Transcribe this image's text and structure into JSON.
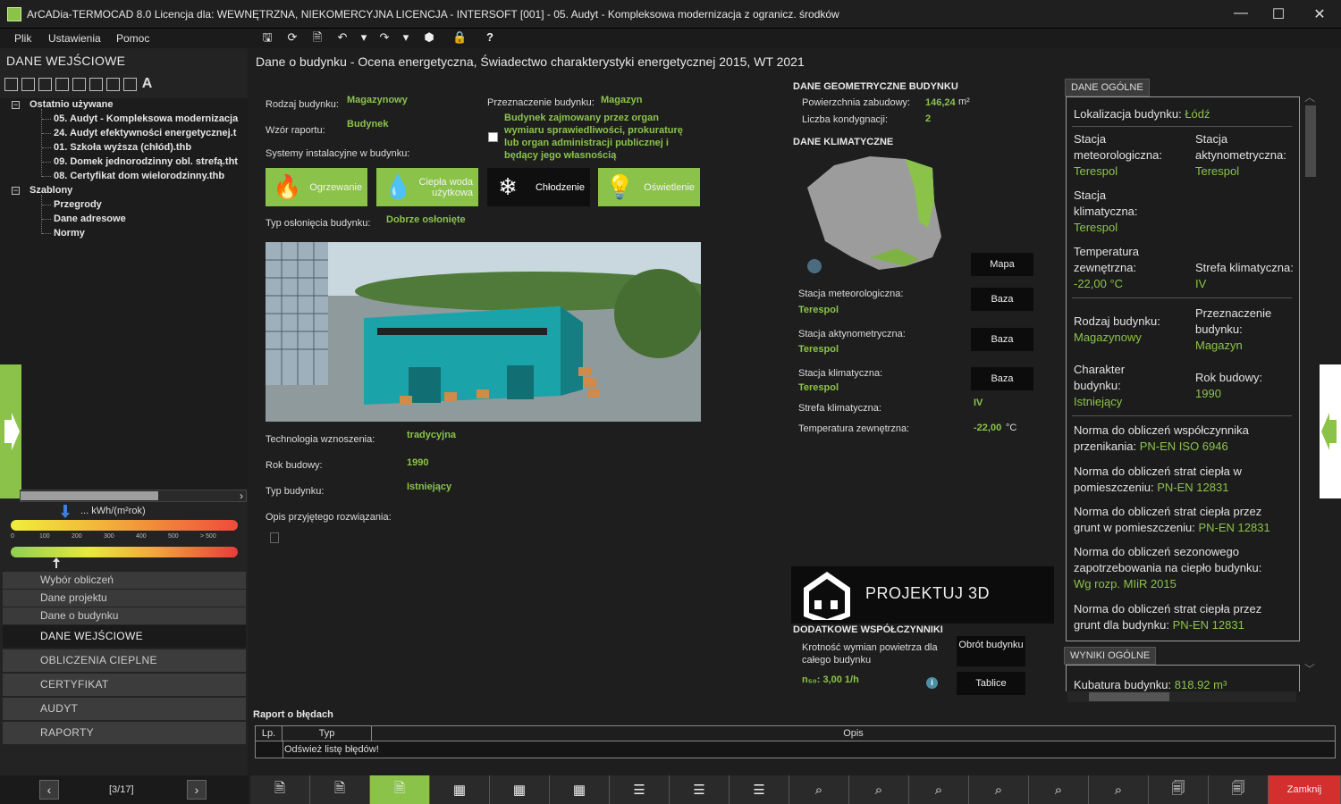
{
  "window": {
    "title": "ArCADia-TERMOCAD 8.0 Licencja dla: WEWNĘTRZNA, NIEKOMERCYJNA LICENCJA - INTERSOFT [001] - 05. Audyt - Kompleksowa modernizacja z ogranicz. środków",
    "min": "—",
    "max": "☐",
    "close": "✕"
  },
  "menu": {
    "plik": "Plik",
    "ustawienia": "Ustawienia",
    "pomoc": "Pomoc"
  },
  "toolbar": {
    "save": "🖫",
    "refresh": "⟳",
    "doc": "🗎",
    "undo": "↶",
    "undo_dd": "▾",
    "redo": "↷",
    "redo_dd": "▾",
    "box": "⬢",
    "lock": "🔒",
    "help": "?"
  },
  "left": {
    "header": "DANE WEJŚCIOWE",
    "tree": {
      "recent_label": "Ostatnio używane",
      "recent": [
        "05. Audyt - Kompleksowa modernizacja",
        "24. Audyt efektywności energetycznej.t",
        "01. Szkoła wyższa (chłód).thb",
        "09. Domek jednorodzinny obl. strefą.tht",
        "08. Certyfikat dom wielorodzinny.thb"
      ],
      "templates_label": "Szablony",
      "templates": [
        "Przegrody",
        "Dane adresowe",
        "Normy"
      ],
      "expand": "−"
    },
    "energy": {
      "unit": "... kWh/(m²rok)",
      "ticks": [
        "0",
        "100",
        "200",
        "300",
        "400",
        "500",
        "> 500"
      ]
    },
    "nav": [
      "Wybór obliczeń",
      "Dane projektu",
      "Dane o budynku"
    ],
    "big": [
      "DANE WEJŚCIOWE",
      "OBLICZENIA CIEPLNE",
      "CERTYFIKAT",
      "AUDYT",
      "RAPORTY"
    ],
    "pager": {
      "prev": "‹",
      "next": "›",
      "label": "[3/17]"
    },
    "scroll_right": "›"
  },
  "main": {
    "title": "Dane o budynku - Ocena energetyczna, Świadectwo charakterystyki energetycznej 2015, WT 2021",
    "rodzaj_lbl": "Rodzaj budynku:",
    "rodzaj_val": "Magazynowy",
    "wzor_lbl": "Wzór raportu:",
    "wzor_val": "Budynek",
    "przezn_lbl": "Przeznaczenie budynku:",
    "przezn_val": "Magazyn",
    "checkbox_text": "Budynek zajmowany przez organ wymiaru sprawiedliwości, prokuraturę lub organ administracji publicznej i będący jego własnością",
    "systemy_lbl": "Systemy instalacyjne w budynku:",
    "systems": [
      {
        "label": "Ogrzewanie",
        "icon": "🔥"
      },
      {
        "label": "Ciepła woda użytkowa",
        "icon": "💧"
      },
      {
        "label": "Chłodzenie",
        "icon": "❄"
      },
      {
        "label": "Oświetlenie",
        "icon": "💡"
      }
    ],
    "oslon_lbl": "Typ osłonięcia budynku:",
    "oslon_val": "Dobrze osłonięte",
    "techn_lbl": "Technologia wznoszenia:",
    "techn_val": "tradycyjna",
    "rok_lbl": "Rok budowy:",
    "rok_val": "1990",
    "typ_lbl": "Typ budynku:",
    "typ_val": "Istniejący",
    "opis_lbl": "Opis przyjętego rozwiązania:"
  },
  "geo": {
    "header": "DANE GEOMETRYCZNE BUDYNKU",
    "pow_lbl": "Powierzchnia zabudowy:",
    "pow_val": "146,24",
    "pow_unit": "m²",
    "kond_lbl": "Liczba kondygnacji:",
    "kond_val": "2"
  },
  "klim": {
    "header": "DANE KLIMATYCZNE",
    "mapa": "Mapa",
    "baza": "Baza",
    "meteo_lbl": "Stacja meteorologiczna:",
    "meteo_val": "Terespol",
    "akty_lbl": "Stacja aktynometryczna:",
    "akty_val": "Terespol",
    "stk_lbl": "Stacja klimatyczna:",
    "stk_val": "Terespol",
    "strefa_lbl": "Strefa klimatyczna:",
    "strefa_val": "IV",
    "temp_lbl": "Temperatura zewnętrzna:",
    "temp_val": "-22,00",
    "temp_unit": "°C"
  },
  "proj": {
    "label": "PROJEKTUJ 3D"
  },
  "dodatkowe": {
    "header": "DODATKOWE WSPÓŁCZYNNIKI",
    "krot_lbl": "Krotność wymian powietrza dla całego budynku",
    "n50": "n₅₀: 3,00 1/h",
    "obrot": "Obrót budynku",
    "tablice": "Tablice",
    "info": "i"
  },
  "right": {
    "tab_ogolne": "DANE OGÓLNE",
    "tab_wyniki": "WYNIKI OGÓLNE",
    "lok_lbl": "Lokalizacja budynku:",
    "lok_val": "Łódź",
    "st_meteo_lbl": "Stacja meteorologiczna:",
    "st_meteo_val": "Terespol",
    "st_akty_lbl": "Stacja aktynometryczna:",
    "st_akty_val": "Terespol",
    "st_klim_lbl": "Stacja klimatyczna:",
    "st_klim_val": "Terespol",
    "temp_lbl": "Temperatura zewnętrzna:",
    "temp_val": "-22,00 °C",
    "strefa_lbl": "Strefa klimatyczna:",
    "strefa_val": "IV",
    "rodzaj_lbl": "Rodzaj budynku:",
    "rodzaj_val": "Magazynowy",
    "przezn_lbl": "Przeznaczenie budynku:",
    "przezn_val": "Magazyn",
    "char_lbl": "Charakter budynku:",
    "char_val": "Istniejący",
    "rok_lbl": "Rok budowy:",
    "rok_val": "1990",
    "n1_lbl": "Norma do obliczeń współczynnika przenikania:",
    "n1_val": "PN-EN ISO 6946",
    "n2_lbl": "Norma do obliczeń strat ciepła w pomieszczeniu:",
    "n2_val": "PN-EN 12831",
    "n3_lbl": "Norma do obliczeń strat ciepła przez grunt w pomieszczeniu:",
    "n3_val": "PN-EN 12831",
    "n4_lbl": "Norma do obliczeń sezonowego zapotrzebowania na ciepło budynku:",
    "n4_val": "Wg rozp. MIiR 2015",
    "n5_lbl": "Norma do obliczeń strat ciepła przez grunt dla budynku:",
    "n5_val": "PN-EN 12831",
    "kub_lbl": "Kubatura budynku:",
    "kub_val": "818.92 m³"
  },
  "errors": {
    "header": "Raport o błędach",
    "col_lp": "Lp.",
    "col_typ": "Typ",
    "col_opis": "Opis",
    "refresh": "Odśwież listę błędów!"
  },
  "bottom": {
    "close": "Zamknij"
  }
}
